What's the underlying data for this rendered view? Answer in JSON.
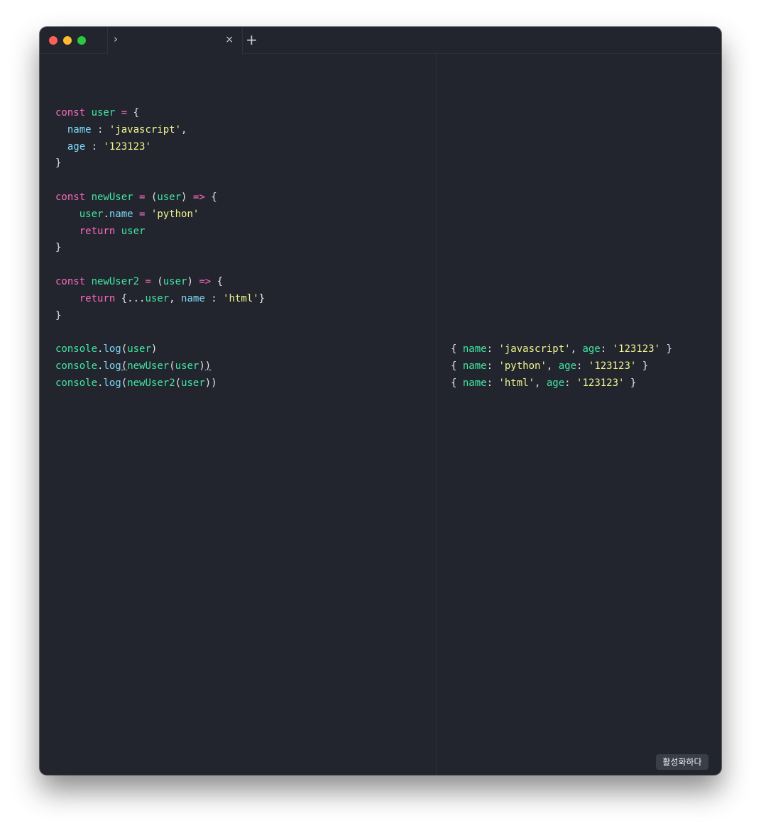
{
  "code_lines": [
    [
      {
        "c": "kw",
        "t": "const "
      },
      {
        "c": "id",
        "t": "user "
      },
      {
        "c": "kw",
        "t": "= "
      },
      {
        "c": "pl",
        "t": "{"
      }
    ],
    [
      {
        "c": "pl",
        "t": "  "
      },
      {
        "c": "prop",
        "t": "name "
      },
      {
        "c": "pl",
        "t": ": "
      },
      {
        "c": "str",
        "t": "'javascript'"
      },
      {
        "c": "pl",
        "t": ","
      }
    ],
    [
      {
        "c": "pl",
        "t": "  "
      },
      {
        "c": "prop",
        "t": "age "
      },
      {
        "c": "pl",
        "t": ": "
      },
      {
        "c": "str",
        "t": "'123123'"
      }
    ],
    [
      {
        "c": "pl",
        "t": "}"
      }
    ],
    [],
    [
      {
        "c": "kw",
        "t": "const "
      },
      {
        "c": "id",
        "t": "newUser "
      },
      {
        "c": "kw",
        "t": "= "
      },
      {
        "c": "pl",
        "t": "("
      },
      {
        "c": "id",
        "t": "user"
      },
      {
        "c": "pl",
        "t": ") "
      },
      {
        "c": "kw",
        "t": "=> "
      },
      {
        "c": "pl",
        "t": "{"
      }
    ],
    [
      {
        "c": "pl",
        "t": "    "
      },
      {
        "c": "id",
        "t": "user"
      },
      {
        "c": "pl",
        "t": "."
      },
      {
        "c": "prop",
        "t": "name "
      },
      {
        "c": "kw",
        "t": "= "
      },
      {
        "c": "str",
        "t": "'python'"
      }
    ],
    [
      {
        "c": "pl",
        "t": "    "
      },
      {
        "c": "kw",
        "t": "return "
      },
      {
        "c": "id",
        "t": "user"
      }
    ],
    [
      {
        "c": "pl",
        "t": "}"
      }
    ],
    [],
    [
      {
        "c": "kw",
        "t": "const "
      },
      {
        "c": "id",
        "t": "newUser2 "
      },
      {
        "c": "kw",
        "t": "= "
      },
      {
        "c": "pl",
        "t": "("
      },
      {
        "c": "id",
        "t": "user"
      },
      {
        "c": "pl",
        "t": ") "
      },
      {
        "c": "kw",
        "t": "=> "
      },
      {
        "c": "pl",
        "t": "{"
      }
    ],
    [
      {
        "c": "pl",
        "t": "    "
      },
      {
        "c": "kw",
        "t": "return "
      },
      {
        "c": "pl",
        "t": "{..."
      },
      {
        "c": "id",
        "t": "user"
      },
      {
        "c": "pl",
        "t": ", "
      },
      {
        "c": "prop",
        "t": "name "
      },
      {
        "c": "pl",
        "t": ": "
      },
      {
        "c": "str",
        "t": "'html'"
      },
      {
        "c": "pl",
        "t": "}"
      }
    ],
    [
      {
        "c": "pl",
        "t": "}"
      }
    ],
    [],
    [
      {
        "c": "id",
        "t": "console"
      },
      {
        "c": "pl",
        "t": "."
      },
      {
        "c": "prop",
        "t": "log"
      },
      {
        "c": "pl",
        "t": "("
      },
      {
        "c": "id",
        "t": "user"
      },
      {
        "c": "pl",
        "t": ")"
      }
    ],
    [
      {
        "c": "id",
        "t": "console"
      },
      {
        "c": "pl",
        "t": "."
      },
      {
        "c": "prop",
        "t": "log"
      },
      {
        "c": "pl u",
        "t": "("
      },
      {
        "c": "id",
        "t": "newUser"
      },
      {
        "c": "pl",
        "t": "("
      },
      {
        "c": "id",
        "t": "user"
      },
      {
        "c": "pl",
        "t": ")"
      },
      {
        "c": "pl u",
        "t": ")"
      }
    ],
    [
      {
        "c": "id",
        "t": "console"
      },
      {
        "c": "pl",
        "t": "."
      },
      {
        "c": "prop",
        "t": "log"
      },
      {
        "c": "pl",
        "t": "("
      },
      {
        "c": "id",
        "t": "newUser2"
      },
      {
        "c": "pl",
        "t": "("
      },
      {
        "c": "id",
        "t": "user"
      },
      {
        "c": "pl",
        "t": "))"
      }
    ]
  ],
  "output_lines": [
    [
      {
        "c": "pl",
        "t": "{ "
      },
      {
        "c": "id",
        "t": "name"
      },
      {
        "c": "pl",
        "t": ": "
      },
      {
        "c": "str",
        "t": "'javascript'"
      },
      {
        "c": "pl",
        "t": ", "
      },
      {
        "c": "id",
        "t": "age"
      },
      {
        "c": "pl",
        "t": ": "
      },
      {
        "c": "str",
        "t": "'123123'"
      },
      {
        "c": "pl",
        "t": " }"
      }
    ],
    [
      {
        "c": "pl",
        "t": "{ "
      },
      {
        "c": "id",
        "t": "name"
      },
      {
        "c": "pl",
        "t": ": "
      },
      {
        "c": "str",
        "t": "'python'"
      },
      {
        "c": "pl",
        "t": ", "
      },
      {
        "c": "id",
        "t": "age"
      },
      {
        "c": "pl",
        "t": ": "
      },
      {
        "c": "str",
        "t": "'123123'"
      },
      {
        "c": "pl",
        "t": " }"
      }
    ],
    [
      {
        "c": "pl",
        "t": "{ "
      },
      {
        "c": "id",
        "t": "name"
      },
      {
        "c": "pl",
        "t": ": "
      },
      {
        "c": "str",
        "t": "'html'"
      },
      {
        "c": "pl",
        "t": ", "
      },
      {
        "c": "id",
        "t": "age"
      },
      {
        "c": "pl",
        "t": ": "
      },
      {
        "c": "str",
        "t": "'123123'"
      },
      {
        "c": "pl",
        "t": " }"
      }
    ]
  ],
  "tab": {
    "chevron": "›",
    "close": "×"
  },
  "new_tab_label": "+",
  "activate_label": "활성화하다",
  "colors": {
    "background": "#22252e",
    "keyword": "#ff6ac1",
    "identifier": "#42e6a4",
    "property": "#7fd8f8",
    "string": "#f1f58f",
    "plain": "#e3e5ea"
  },
  "icons": {
    "tab_prompt": "chevron-right-icon",
    "tab_close": "close-icon",
    "new_tab": "plus-icon"
  }
}
